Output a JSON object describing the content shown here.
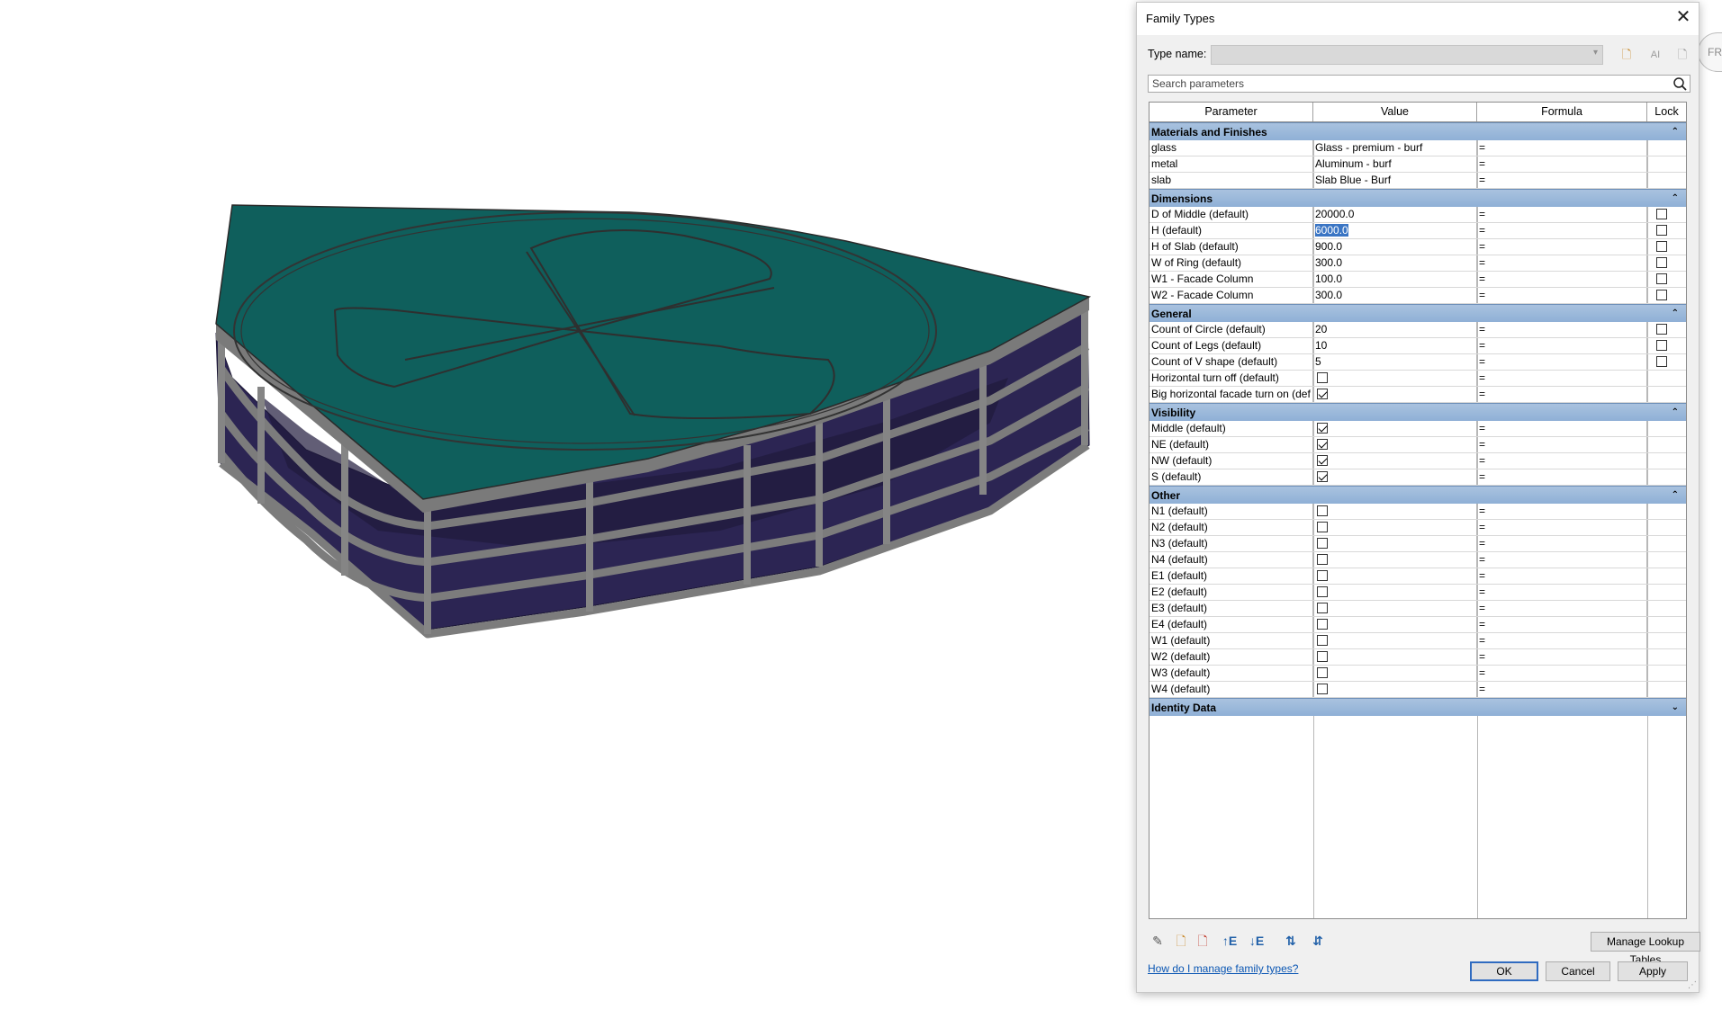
{
  "dialog": {
    "title": "Family Types",
    "type_name_label": "Type name:",
    "type_name_value": "",
    "search_placeholder": "Search parameters",
    "columns": [
      "Parameter",
      "Value",
      "Formula",
      "Lock"
    ],
    "groups": [
      {
        "name": "Materials and Finishes",
        "collapsed": false,
        "rows": [
          {
            "param": "glass",
            "value": "Glass - premium - burf",
            "formula": "=",
            "lock": null
          },
          {
            "param": "metal",
            "value": "Aluminum - burf",
            "formula": "=",
            "lock": null
          },
          {
            "param": "slab",
            "value": "Slab Blue - Burf",
            "formula": "=",
            "lock": null
          }
        ]
      },
      {
        "name": "Dimensions",
        "collapsed": false,
        "rows": [
          {
            "param": "D of Middle (default)",
            "value": "20000.0",
            "formula": "=",
            "lock": false
          },
          {
            "param": "H (default)",
            "value": "6000.0",
            "formula": "=",
            "lock": false,
            "selected": true
          },
          {
            "param": "H of Slab (default)",
            "value": "900.0",
            "formula": "=",
            "lock": false
          },
          {
            "param": "W of Ring (default)",
            "value": "300.0",
            "formula": "=",
            "lock": false
          },
          {
            "param": "W1 - Facade Column",
            "value": "100.0",
            "formula": "=",
            "lock": false
          },
          {
            "param": "W2 - Facade Column",
            "value": "300.0",
            "formula": "=",
            "lock": false
          }
        ]
      },
      {
        "name": "General",
        "collapsed": false,
        "rows": [
          {
            "param": "Count of Circle (default)",
            "value": "20",
            "formula": "=",
            "lock": false
          },
          {
            "param": "Count of Legs (default)",
            "value": "10",
            "formula": "=",
            "lock": false
          },
          {
            "param": "Count of V shape (default)",
            "value": "5",
            "formula": "=",
            "lock": false
          },
          {
            "param": "Horizontal turn off (default)",
            "checkbox": false,
            "formula": "=",
            "lock": null
          },
          {
            "param": "Big horizontal facade turn on (def",
            "checkbox": true,
            "formula": "=",
            "lock": null
          }
        ]
      },
      {
        "name": "Visibility",
        "collapsed": false,
        "rows": [
          {
            "param": "Middle (default)",
            "checkbox": true,
            "formula": "=",
            "lock": null
          },
          {
            "param": "NE (default)",
            "checkbox": true,
            "formula": "=",
            "lock": null
          },
          {
            "param": "NW (default)",
            "checkbox": true,
            "formula": "=",
            "lock": null
          },
          {
            "param": "S (default)",
            "checkbox": true,
            "formula": "=",
            "lock": null
          }
        ]
      },
      {
        "name": "Other",
        "collapsed": false,
        "rows": [
          {
            "param": "N1 (default)",
            "checkbox": false,
            "formula": "=",
            "lock": null
          },
          {
            "param": "N2 (default)",
            "checkbox": false,
            "formula": "=",
            "lock": null
          },
          {
            "param": "N3 (default)",
            "checkbox": false,
            "formula": "=",
            "lock": null
          },
          {
            "param": "N4 (default)",
            "checkbox": false,
            "formula": "=",
            "lock": null
          },
          {
            "param": "E1 (default)",
            "checkbox": false,
            "formula": "=",
            "lock": null
          },
          {
            "param": "E2 (default)",
            "checkbox": false,
            "formula": "=",
            "lock": null
          },
          {
            "param": "E3 (default)",
            "checkbox": false,
            "formula": "=",
            "lock": null
          },
          {
            "param": "E4 (default)",
            "checkbox": false,
            "formula": "=",
            "lock": null
          },
          {
            "param": "W1 (default)",
            "checkbox": false,
            "formula": "=",
            "lock": null
          },
          {
            "param": "W2 (default)",
            "checkbox": false,
            "formula": "=",
            "lock": null
          },
          {
            "param": "W3 (default)",
            "checkbox": false,
            "formula": "=",
            "lock": null
          },
          {
            "param": "W4 (default)",
            "checkbox": false,
            "formula": "=",
            "lock": null
          }
        ]
      },
      {
        "name": "Identity Data",
        "collapsed": true,
        "rows": []
      }
    ],
    "toolbar_icons": [
      "new-type-icon",
      "rename-type-icon",
      "delete-type-icon"
    ],
    "bottom_icons": [
      "edit-parameter-icon",
      "new-parameter-icon",
      "delete-parameter-icon",
      "move-parameter-up-icon",
      "move-parameter-down-icon",
      "sort-ascending-icon",
      "sort-descending-icon"
    ],
    "manage_lookup_label": "Manage Lookup Tables",
    "help_link": "How do I manage family types?",
    "ok_label": "OK",
    "cancel_label": "Cancel",
    "apply_label": "Apply"
  },
  "corner_tab_text": "FRO",
  "colors": {
    "group_header": "#9bb7da",
    "roof": "#0f5f5c",
    "glass": "#2c2553",
    "frame": "#8a8a8a",
    "selection": "#3a75c4"
  }
}
